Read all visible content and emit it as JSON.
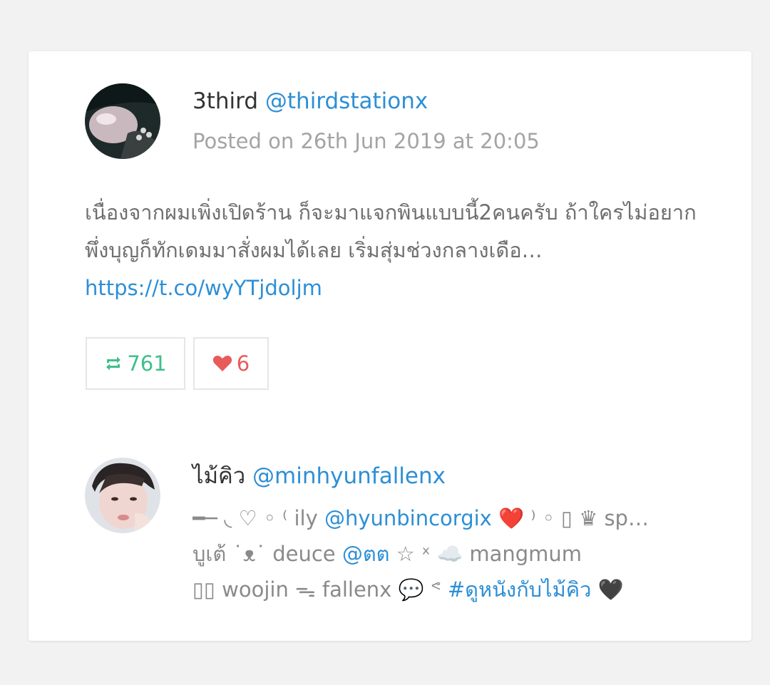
{
  "post": {
    "author": {
      "display_name": "3third",
      "handle": "@thirdstationx"
    },
    "posted": "Posted on 26th Jun 2019 at 20:05",
    "text": "เนื่องจากผมเพิ่งเปิดร้าน ก็จะมาแจกพินแบบนี้2คนครับ ถ้าใครไม่อยากพึ่งบุญก็ทักเดมมาสั่งผมได้เลย เริ่มสุ่มช่วงกลางเดือ… ",
    "link": "https://t.co/wyYTjdoljm",
    "retweets": "761",
    "likes": "6"
  },
  "user": {
    "display_name": "ไม้คิว",
    "handle": "@minhyunfallenx",
    "bio_line1_a": "━─ ◟ ♡ ◦ ⁽ ily ",
    "bio_line1_mention": "@hyunbincorgix",
    "bio_line1_heart": " ❤️",
    "bio_line1_b": " ⁾ ◦ ▯ ♛ sp…",
    "bio_line2_a": "บูเต้ ˙ᴥ˙ deuce ",
    "bio_line2_mention": "@ตต",
    "bio_line2_b": " ☆ ˣ ☁️ mangmum",
    "bio_line3_a": "▯▯ woojin ᯓ fallenx 💬 ᕝ ",
    "bio_line3_hashtag": "#ดูหนังกับไม้คิว",
    "bio_line3_heart": " 🖤"
  },
  "colors": {
    "link": "#2d8fd5",
    "retweet": "#3fbf8a",
    "like": "#e85b5b",
    "muted": "#a4a4a4"
  },
  "icons": {
    "retweet": "retweet-icon",
    "like": "heart-icon"
  }
}
